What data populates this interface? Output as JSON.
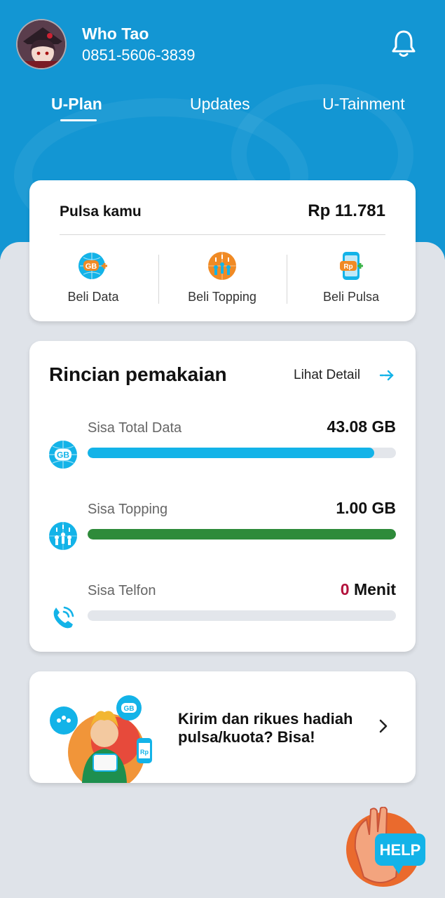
{
  "user": {
    "name": "Who Tao",
    "phone": "0851-5606-3839"
  },
  "tabs": [
    {
      "label": "U-Plan",
      "active": true
    },
    {
      "label": "Updates",
      "active": false
    },
    {
      "label": "U-Tainment",
      "active": false
    }
  ],
  "balance": {
    "label": "Pulsa kamu",
    "value": "Rp 11.781"
  },
  "actions": [
    {
      "label": "Beli Data",
      "icon": "gb-globe-icon"
    },
    {
      "label": "Beli Topping",
      "icon": "topping-globe-icon"
    },
    {
      "label": "Beli Pulsa",
      "icon": "rp-phone-icon"
    }
  ],
  "usage": {
    "title": "Rincian pemakaian",
    "detail_link": "Lihat Detail",
    "rows": [
      {
        "label": "Sisa Total Data",
        "value": "43.08 GB",
        "fill_fraction": 0.93,
        "color": "#13b3e8",
        "icon": "gb-globe-icon"
      },
      {
        "label": "Sisa Topping",
        "value": "1.00 GB",
        "fill_fraction": 1.0,
        "color": "#2e8b3a",
        "icon": "topping-globe-icon"
      },
      {
        "label": "Sisa Telfon",
        "value_number": "0",
        "value_unit": "Menit",
        "fill_fraction": 0.0,
        "color": "#b3123c",
        "icon": "phone-call-icon"
      }
    ]
  },
  "promo": {
    "text": "Kirim dan rikues hadiah pulsa/kuota? Bisa!"
  },
  "help": {
    "label": "HELP"
  },
  "colors": {
    "header_blue": "#1396d3",
    "accent_cyan": "#13b3e8",
    "topping_green": "#2e8b3a",
    "zero_red": "#b3123c"
  }
}
